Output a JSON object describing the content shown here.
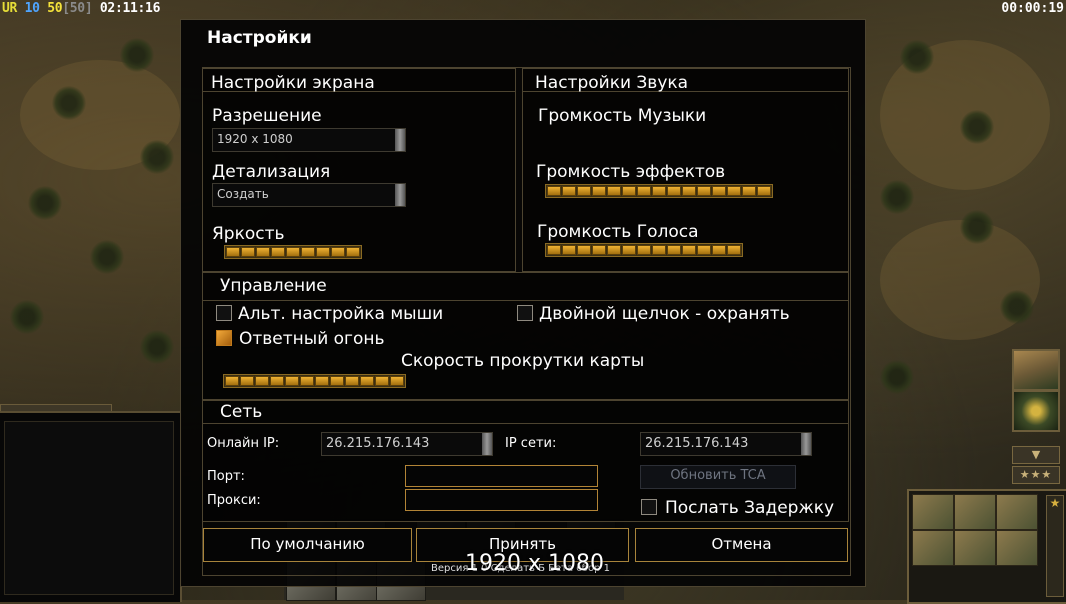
{
  "hud": {
    "ur": "UR",
    "val10": "10",
    "val50": "50",
    "bracket50": "[50]",
    "clock": "02:11:16",
    "timer": "00:00:19"
  },
  "side_panel": {
    "arrow_glyph": "▼",
    "stars_glyph": "★★★"
  },
  "dialog": {
    "title": "Настройки",
    "screen": {
      "title": "Настройки экрана",
      "resolution_label": "Разрешение",
      "resolution_value": "1920 x 1080",
      "detail_label": "Детализация",
      "detail_value": "Создать",
      "brightness_label": "Яркость",
      "brightness_segments": 9
    },
    "sound": {
      "title": "Настройки Звука",
      "music_label": "Громкость Музыки",
      "effects_label": "Громкость эффектов",
      "effects_segments": 15,
      "voice_label": "Громкость Голоса",
      "voice_segments": 13
    },
    "controls": {
      "title": "Управление",
      "alt_mouse_label": "Альт. настройка мыши",
      "alt_mouse_checked": false,
      "double_click_label": "Двойной щелчок - охранять",
      "double_click_checked": false,
      "return_fire_label": "Ответный огонь",
      "return_fire_checked": true,
      "scroll_speed_label": "Скорость прокрутки карты",
      "scroll_speed_segments": 12
    },
    "network": {
      "title": "Сеть",
      "online_ip_label": "Онлайн IP:",
      "online_ip_value": "26.215.176.143",
      "lan_ip_label": "IP сети:",
      "lan_ip_value": "26.215.176.143",
      "port_label": "Порт:",
      "port_value": "",
      "proxy_label": "Прокси:",
      "proxy_value": "",
      "update_tca_label": "Обновить TCA",
      "send_delay_label": "Послать Задержку",
      "send_delay_checked": false
    },
    "buttons": {
      "defaults": "По умолчанию",
      "accept": "Принять",
      "cancel": "Отмена"
    },
    "version_text": "Версия 1 0 Сделать Б Бета сбор 1",
    "resolution_overlay": "1920 x 1080"
  },
  "colors": {
    "slider_fill": "#f0b233",
    "border": "#4d4430",
    "button_border": "#a8843b",
    "field_border": "#b28436"
  }
}
